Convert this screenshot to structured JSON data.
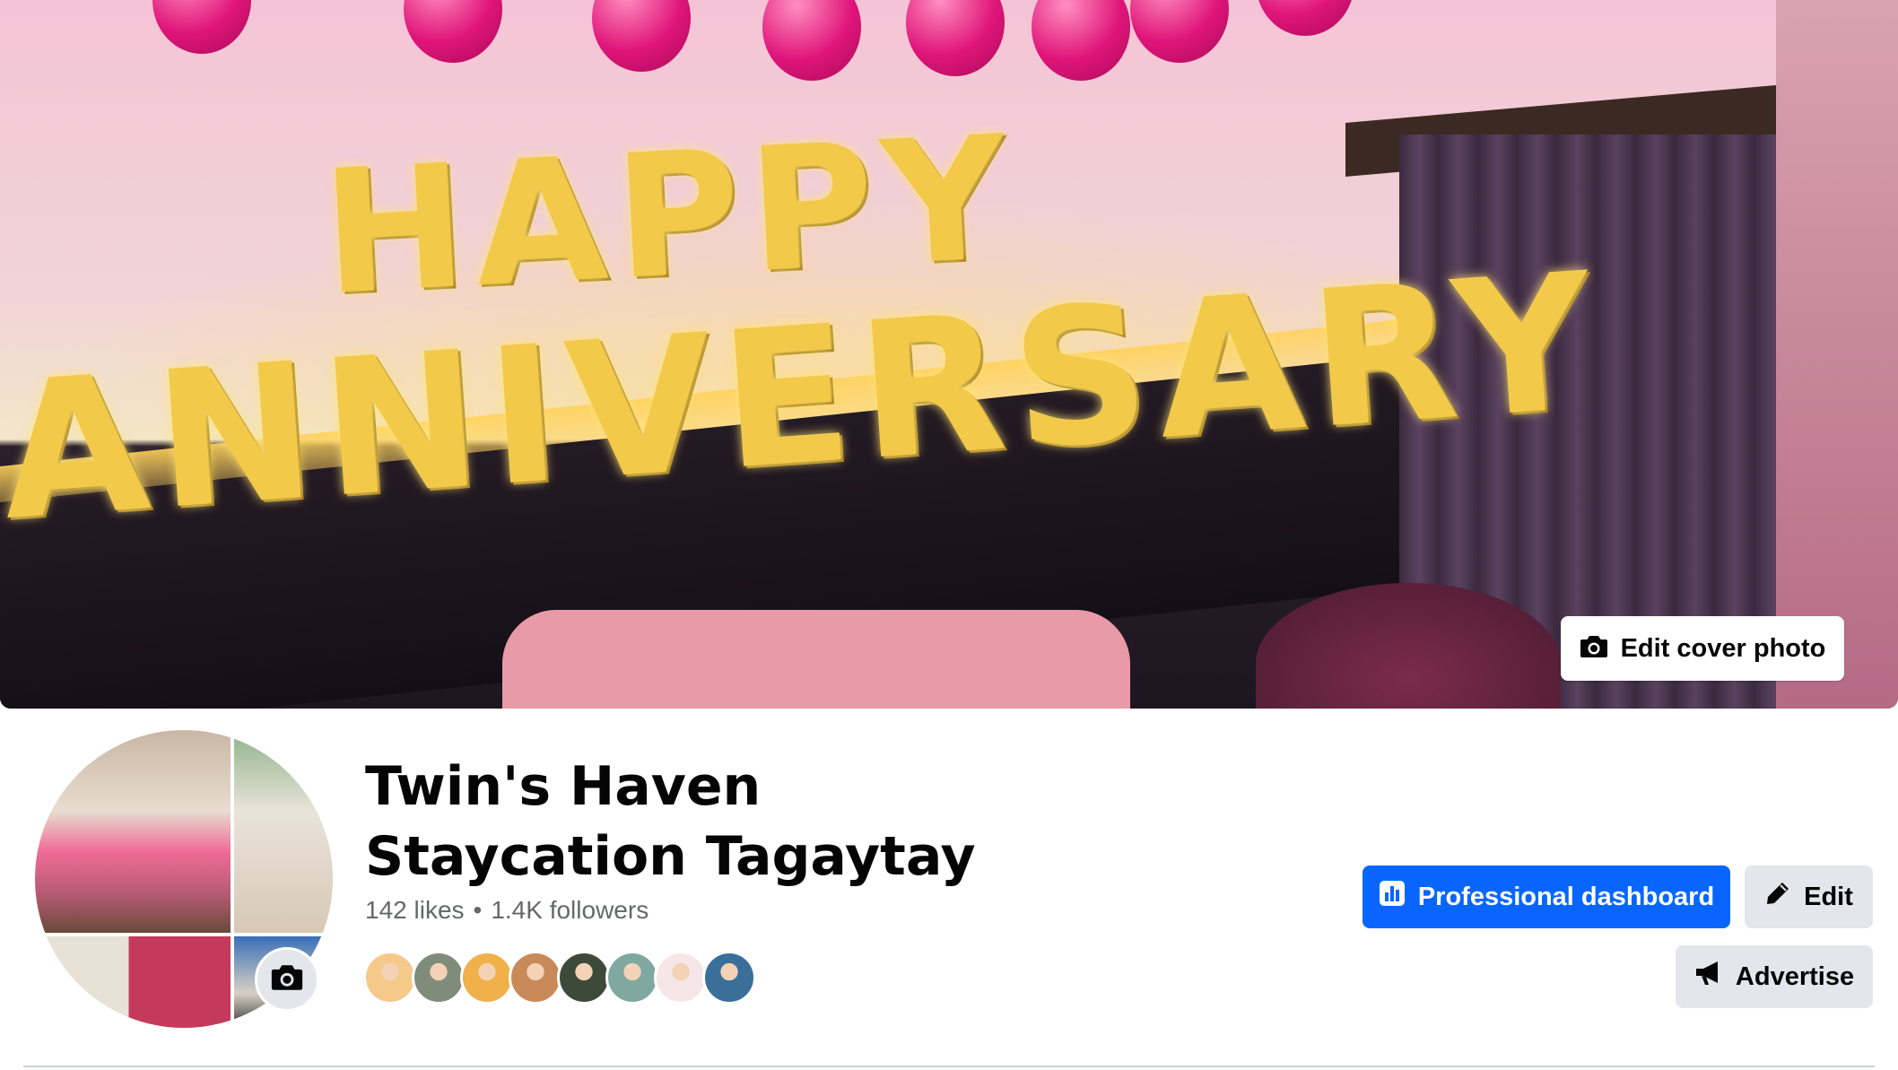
{
  "cover": {
    "banner_line_1": "HAPPY",
    "banner_line_2": "ANNIVERSARY",
    "edit_cover_label": "Edit cover photo"
  },
  "profile": {
    "name": "Twin's Haven Staycation Tagaytay",
    "likes": "142 likes",
    "separator": "•",
    "followers": "1.4K followers",
    "follower_avatar_colors": [
      "#f5c98a",
      "#7f8c7a",
      "#f0b04a",
      "#c98a5a",
      "#3d4a3a",
      "#7fa8a0",
      "#f6e6ea",
      "#3a6f9a"
    ]
  },
  "actions": {
    "primary_label": "Professional dashboard",
    "edit_label": "Edit",
    "advertise_label": "Advertise"
  },
  "colors": {
    "primary": "#0866ff",
    "secondary_bg": "#e4e6eb",
    "muted_text": "#65676b"
  },
  "icons": {
    "edit_cover": "camera-icon",
    "avatar_update": "camera-icon",
    "dashboard": "bar-chart-icon",
    "edit": "pencil-icon",
    "advertise": "megaphone-icon"
  }
}
